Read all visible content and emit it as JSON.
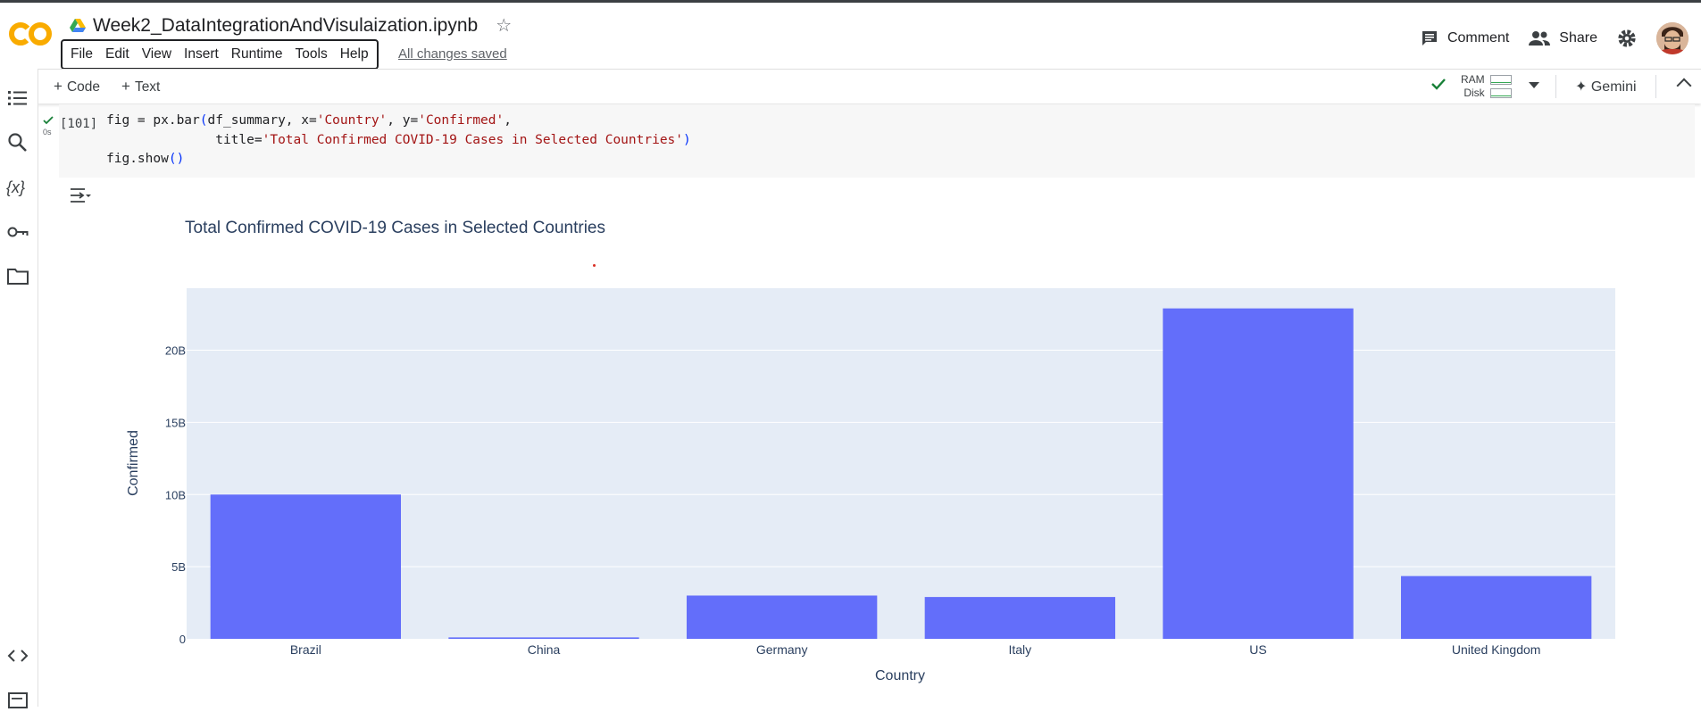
{
  "header": {
    "notebook_title": "Week2_DataIntegrationAndVisulaization.ipynb",
    "menu": [
      "File",
      "Edit",
      "View",
      "Insert",
      "Runtime",
      "Tools",
      "Help"
    ],
    "save_status": "All changes saved",
    "comment_label": "Comment",
    "share_label": "Share"
  },
  "toolbar": {
    "add_code_label": "Code",
    "add_text_label": "Text",
    "ram_label": "RAM",
    "disk_label": "Disk",
    "gemini_label": "Gemini"
  },
  "cell": {
    "status": "0s",
    "execution_count": "[101]",
    "code_lines": [
      [
        "fig = px.bar",
        "(",
        "df_summary, x=",
        "'Country'",
        ", y=",
        "'Confirmed'",
        ","
      ],
      [
        "              title=",
        "'Total Confirmed COVID-19 Cases in Selected Countries'",
        ")"
      ],
      [
        "fig.show",
        "()"
      ]
    ]
  },
  "chart_data": {
    "type": "bar",
    "title": "Total Confirmed COVID-19 Cases in Selected Countries",
    "xlabel": "Country",
    "ylabel": "Confirmed",
    "categories": [
      "Brazil",
      "China",
      "Germany",
      "Italy",
      "US",
      "United Kingdom"
    ],
    "values": [
      10000000000.0,
      100000000.0,
      3000000000.0,
      2900000000.0,
      22900000000.0,
      4350000000.0
    ],
    "ylim": [
      0,
      24300000000.0
    ],
    "yticks": [
      0,
      5000000000.0,
      10000000000.0,
      15000000000.0,
      20000000000.0
    ],
    "ytick_labels": [
      "0",
      "5B",
      "10B",
      "15B",
      "20B"
    ],
    "grid": true,
    "bar_color": "#636efa",
    "plot_bg": "#e5ecf6"
  }
}
